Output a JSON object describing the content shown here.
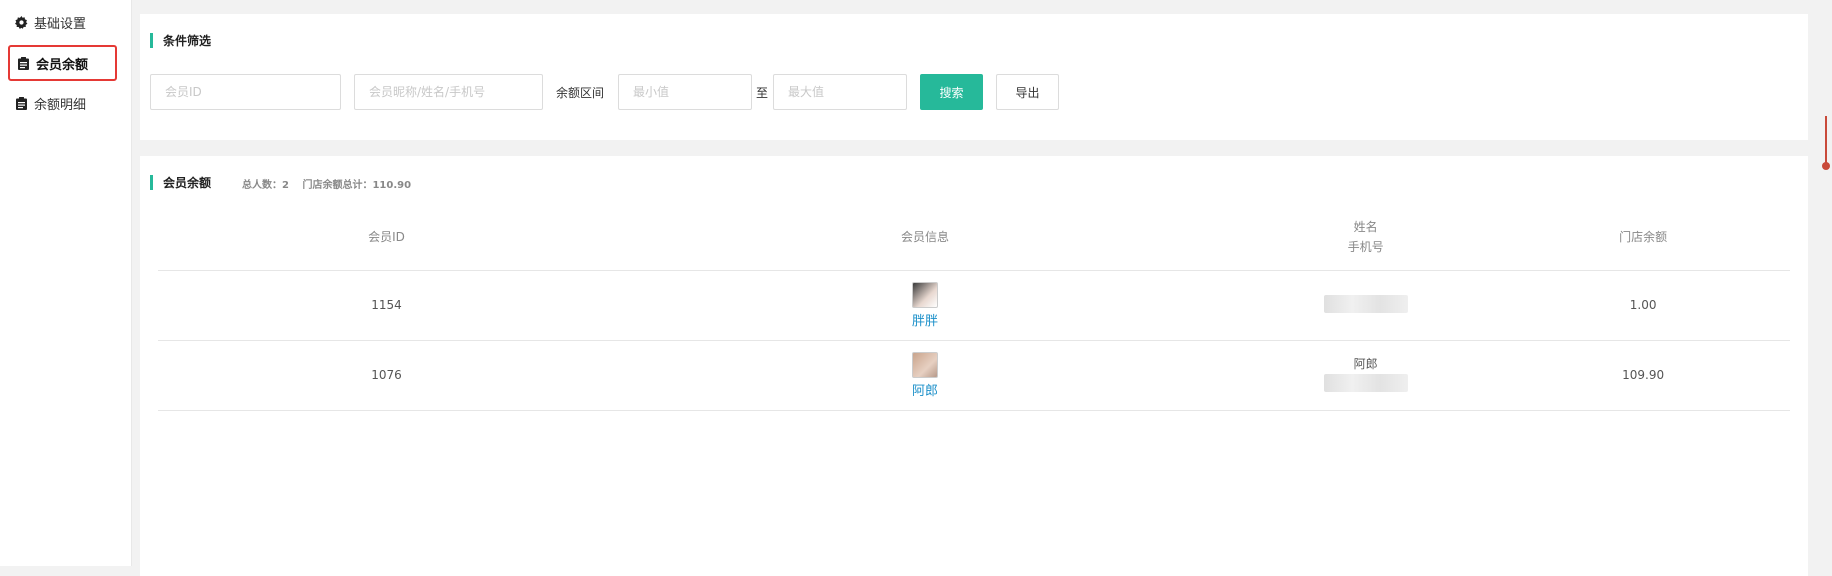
{
  "sidebar": {
    "items": [
      {
        "label": "基础设置",
        "icon": "gear-icon"
      },
      {
        "label": "会员余额",
        "icon": "clipboard-icon",
        "active": true
      },
      {
        "label": "余额明细",
        "icon": "clipboard-icon"
      }
    ]
  },
  "filter": {
    "title": "条件筛选",
    "member_id_placeholder": "会员ID",
    "member_info_placeholder": "会员昵称/姓名/手机号",
    "range_label": "余额区间",
    "min_placeholder": "最小值",
    "to_label": "至",
    "max_placeholder": "最大值",
    "search_label": "搜索",
    "export_label": "导出"
  },
  "list": {
    "title": "会员余额",
    "total_people_label": "总人数：2",
    "total_balance_label": "门店余额总计：110.90",
    "columns": {
      "member_id": "会员ID",
      "member_info": "会员信息",
      "name": "姓名",
      "phone": "手机号",
      "balance": "门店余额"
    },
    "rows": [
      {
        "member_id": "1154",
        "nickname": "胖胖",
        "name": "",
        "balance": "1.00"
      },
      {
        "member_id": "1076",
        "nickname": "阿郎",
        "name": "阿郎",
        "balance": "109.90"
      }
    ]
  },
  "colors": {
    "accent": "#26b99a",
    "highlight_border": "#e53935",
    "link": "#1a8fc9"
  }
}
